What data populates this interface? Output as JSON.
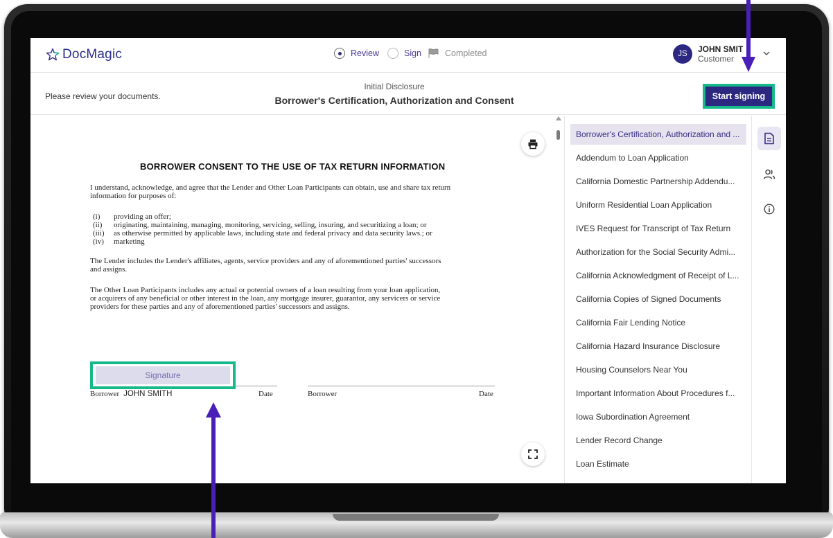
{
  "app": {
    "logo_text": "DocMagic",
    "brand_color": "#2c2781",
    "accent_color": "#17b88a"
  },
  "steps": [
    {
      "label": "Review",
      "state": "active"
    },
    {
      "label": "Sign",
      "state": "inactive"
    },
    {
      "label": "Completed",
      "state": "inactive"
    }
  ],
  "user": {
    "initials": "JS",
    "name": "JOHN SMIT",
    "role": "Customer"
  },
  "subheader": {
    "hint": "Please review your documents.",
    "category": "Initial Disclosure",
    "title": "Borrower's Certification, Authorization and Consent",
    "start_button": "Start signing"
  },
  "document": {
    "heading": "BORROWER CONSENT TO THE USE OF TAX RETURN INFORMATION",
    "intro_line1": "I understand, acknowledge, and agree that the Lender and Other Loan Participants can obtain, use and share tax return",
    "intro_line2": "information for purposes of:",
    "list": [
      {
        "num": "(i)",
        "text": "providing an offer;"
      },
      {
        "num": "(ii)",
        "text": "originating, maintaining, managing, monitoring, servicing, selling, insuring, and securitizing a loan; or"
      },
      {
        "num": "(iii)",
        "text": "as otherwise permitted by applicable laws, including state and federal privacy and data security laws.; or"
      },
      {
        "num": "(iv)",
        "text": "marketing"
      }
    ],
    "para2_line1": "The Lender includes the Lender's affiliates, agents, service providers and any of aforementioned parties' successors",
    "para2_line2": "and assigns.",
    "para3_line1": "The Other Loan Participants includes any actual or potential owners of a loan resulting from your loan application,",
    "para3_line2": "or acquirers of any beneficial or other interest in the loan, any mortgage insurer, guarantor, any servicers or service",
    "para3_line3": "providers for these parties and any of aforementioned  parties' successors and assigns.",
    "signature_field": "Signature",
    "borrower_label": "Borrower",
    "borrower_name": "JOHN SMITH",
    "date_label": "Date",
    "borrower2_label": "Borrower",
    "date2_label": "Date"
  },
  "doc_list": [
    "Borrower's Certification, Authorization and ...",
    "Addendum to Loan Application",
    "California Domestic Partnership Addendu...",
    "Uniform Residential Loan Application",
    "IVES Request for Transcript of Tax Return",
    "Authorization for the Social Security Admi...",
    "California Acknowledgment of Receipt of L...",
    "California Copies of Signed Documents",
    "California Fair Lending Notice",
    "California Hazard Insurance Disclosure",
    "Housing Counselors Near You",
    "Important Information About Procedures f...",
    "Iowa Subordination Agreement",
    "Lender Record Change",
    "Loan Estimate"
  ],
  "side_rail": [
    {
      "icon": "document-icon",
      "active": true
    },
    {
      "icon": "people-icon",
      "active": false
    },
    {
      "icon": "info-icon",
      "active": false
    }
  ]
}
